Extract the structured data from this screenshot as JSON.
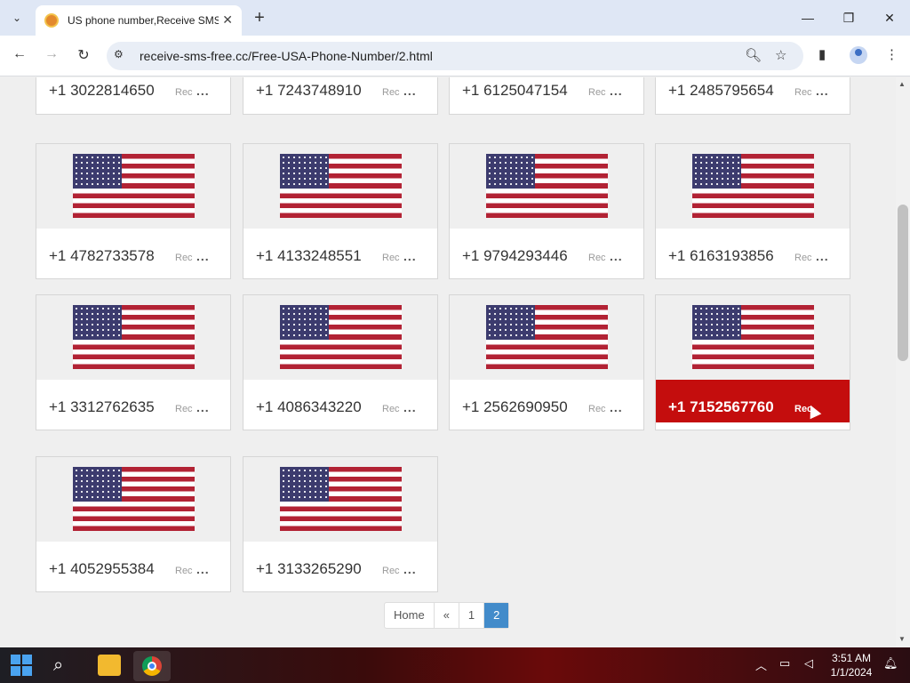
{
  "browser": {
    "tab_title": "US phone number,Receive SMS",
    "url": "receive-sms-free.cc/Free-USA-Phone-Number/2.html",
    "new_tab": "+",
    "tab_close": "✕",
    "minimize": "—",
    "maximize": "❐",
    "close": "✕"
  },
  "cards_top": [
    {
      "number": "+1 3022814650",
      "rec": "Rec",
      "dots": "..."
    },
    {
      "number": "+1 7243748910",
      "rec": "Rec",
      "dots": "..."
    },
    {
      "number": "+1 6125047154",
      "rec": "Rec",
      "dots": "..."
    },
    {
      "number": "+1 2485795654",
      "rec": "Rec",
      "dots": "..."
    }
  ],
  "cards": [
    {
      "number": "+1 4782733578",
      "rec": "Rec",
      "dots": "..."
    },
    {
      "number": "+1 4133248551",
      "rec": "Rec",
      "dots": "..."
    },
    {
      "number": "+1 9794293446",
      "rec": "Rec",
      "dots": "..."
    },
    {
      "number": "+1 6163193856",
      "rec": "Rec",
      "dots": "..."
    },
    {
      "number": "+1 3312762635",
      "rec": "Rec",
      "dots": "..."
    },
    {
      "number": "+1 4086343220",
      "rec": "Rec",
      "dots": "..."
    },
    {
      "number": "+1 2562690950",
      "rec": "Rec",
      "dots": "..."
    },
    {
      "number": "+1 7152567760",
      "rec": "Rec",
      "dots": ""
    },
    {
      "number": "+1 4052955384",
      "rec": "Rec",
      "dots": "..."
    },
    {
      "number": "+1 3133265290",
      "rec": "Rec",
      "dots": "..."
    }
  ],
  "pagination": {
    "home": "Home",
    "prev": "«",
    "page1": "1",
    "page2": "2",
    "current": "2"
  },
  "taskbar": {
    "time": "3:51 AM",
    "date": "1/1/2024"
  },
  "colors": {
    "active_card": "#c40d0d",
    "pagination_active": "#428bca"
  }
}
